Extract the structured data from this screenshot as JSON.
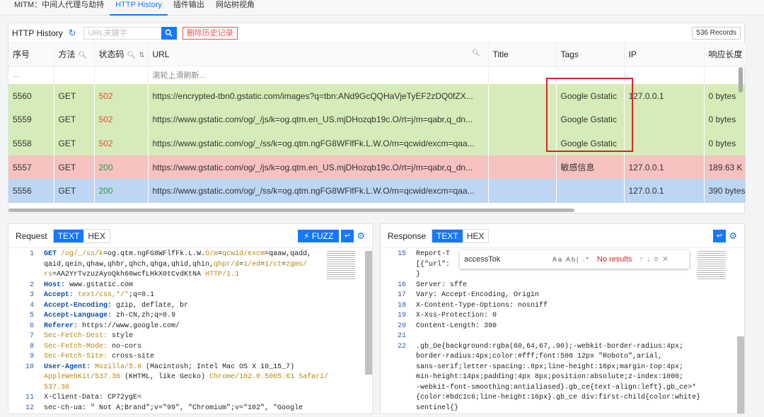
{
  "tabs": [
    "MITM：中间人代理与劫持",
    "HTTP History",
    "插件输出",
    "网站树视角"
  ],
  "history": {
    "title": "HTTP History",
    "search_placeholder": "URL关键字",
    "delete_label": "删除历史记录",
    "records_label": "536 Records",
    "columns": [
      "序号",
      "方法",
      "状态码",
      "URL",
      "Title",
      "Tags",
      "IP",
      "响应长度"
    ],
    "hint_row": "滚轮上滑刷新...",
    "hint_id": "...",
    "rows": [
      {
        "id": "5560",
        "method": "GET",
        "status": "502",
        "url": "https://encrypted-tbn0.gstatic.com/images?q=tbn:ANd9GcQQHaVjeTyEF2zDQ0fZX...",
        "title": "",
        "tags": "Google Gstatic",
        "ip": "127.0.0.1",
        "len": "0 bytes",
        "color": "green"
      },
      {
        "id": "5559",
        "method": "GET",
        "status": "502",
        "url": "https://www.gstatic.com/og/_/js/k=og.qtm.en_US.mjDHozqb19c.O/rt=j/m=qabr,q_dn...",
        "title": "",
        "tags": "Google Gstatic",
        "ip": "",
        "len": "0 bytes",
        "color": "green"
      },
      {
        "id": "5558",
        "method": "GET",
        "status": "502",
        "url": "https://www.gstatic.com/og/_/ss/k=og.qtm.ngFG8WFlfFk.L.W.O/m=qcwid/excm=qaa...",
        "title": "",
        "tags": "Google Gstatic",
        "ip": "",
        "len": "0 bytes",
        "color": "green"
      },
      {
        "id": "5557",
        "method": "GET",
        "status": "200",
        "url": "https://www.gstatic.com/og/_/js/k=og.qtm.en_US.mjDHozqb19c.O/rt=j/m=qabr,q_dn...",
        "title": "",
        "tags": "敏感信息",
        "ip": "127.0.0.1",
        "len": "189.63 K",
        "color": "red"
      },
      {
        "id": "5556",
        "method": "GET",
        "status": "200",
        "url": "https://www.gstatic.com/og/_/ss/k=og.qtm.ngFG8WFlfFk.L.W.O/m=qcwid/excm=qaa...",
        "title": "",
        "tags": "",
        "ip": "127.0.0.1",
        "len": "390 bytes",
        "color": "blue"
      }
    ]
  },
  "request": {
    "label": "Request",
    "text_tab": "TEXT",
    "hex_tab": "HEX",
    "fuzz_label": "FUZZ",
    "lines": [
      {
        "n": "1",
        "html": "<span class='k'>GET</span> <span class='o'>/og/_/ss/k</span>=og.qtm.ngFG8WFlfFk.L.W.<span class='o'>O/m</span>=<span class='o'>qcwid/excm</span>=qaaw,qadd,"
      },
      {
        "n": "",
        "html": "qaid,qein,qhaw,qhbr,qhch,qhga,qhid,qhin,<span class='o'>qhpr/d</span>=<span class='o'>1/ed</span>=<span class='o'>1/ct</span>=<span class='o'>zgms/</span>"
      },
      {
        "n": "",
        "html": "<span class='o'>rs</span>=AA2YrTvzuzAyoQkh60wcfLHkX0tCvdKtNA <span class='o'>HTTP/1.1</span>"
      },
      {
        "n": "2",
        "html": "<span class='k'>Host:</span> www.gstatic.com"
      },
      {
        "n": "3",
        "html": "<span class='k'>Accept:</span> <span class='o'>text/css,*/*</span>;q=0.1"
      },
      {
        "n": "4",
        "html": "<span class='k'>Accept-Encoding:</span> gzip, deflate, br"
      },
      {
        "n": "5",
        "html": "<span class='k'>Accept-Language:</span> zh-CN,zh;q=0.9"
      },
      {
        "n": "6",
        "html": "<span class='k'>Referer:</span> https://www.google.com/"
      },
      {
        "n": "7",
        "html": "<span class='o'>Sec-Fetch-Dest:</span> style"
      },
      {
        "n": "8",
        "html": "<span class='o'>Sec-Fetch-Mode:</span> no-cors"
      },
      {
        "n": "9",
        "html": "<span class='o'>Sec-Fetch-Site:</span> cross-site"
      },
      {
        "n": "10",
        "html": "<span class='k'>User-Agent:</span> <span class='o'>Mozilla/5.0</span> (Macintosh; Intel Mac OS X 10_15_7)"
      },
      {
        "n": "",
        "html": "<span class='o'>AppleWebKit/537.36</span> (KHTML, like Gecko) <span class='o'>Chrome/102.0.5005.61 Safari/</span>"
      },
      {
        "n": "",
        "html": "<span class='o'>537.36</span>"
      },
      {
        "n": "11",
        "html": "X-Client-Data: CP72ygE="
      },
      {
        "n": "12",
        "html": "sec-ch-ua: \" Not A;Brand\";v=\"99\", \"Chromium\";v=\"102\", \"Google"
      }
    ]
  },
  "response": {
    "label": "Response",
    "text_tab": "TEXT",
    "hex_tab": "HEX",
    "find_query": "accessTok",
    "find_opts": "Aa Ab| .*",
    "find_result": "No results",
    "lines": [
      {
        "n": "15",
        "text": "Report-T"
      },
      {
        "n": "",
        "text": "[{\"url\":"
      },
      {
        "n": "",
        "text": "}"
      },
      {
        "n": "16",
        "text": "Server: sffe"
      },
      {
        "n": "17",
        "text": "Vary: Accept-Encoding, Origin"
      },
      {
        "n": "18",
        "text": "X-Content-Type-Options: nosniff"
      },
      {
        "n": "19",
        "text": "X-Xss-Protection: 0"
      },
      {
        "n": "20",
        "text": "Content-Length: 390"
      },
      {
        "n": "21",
        "text": ""
      },
      {
        "n": "22",
        "text": ".gb_Oe{background:rgba(60,64,67,.90);-webkit-border-radius:4px;"
      },
      {
        "n": "",
        "text": "border-radius:4px;color:#fff;font:500 12px \"Roboto\",arial,"
      },
      {
        "n": "",
        "text": "sans-serif;letter-spacing:.8px;line-height:16px;margin-top:4px;"
      },
      {
        "n": "",
        "text": "min-height:14px;padding:4px 8px;position:absolute;z-index:1000;"
      },
      {
        "n": "",
        "text": "-webkit-font-smoothing:antialiased}.gb_ce{text-align:left}.gb_ce>*"
      },
      {
        "n": "",
        "text": "{color:#bdc1c6;line-height:16px}.gb_ce div:first-child{color:white}"
      },
      {
        "n": "",
        "text": "sentinel{}"
      }
    ]
  }
}
